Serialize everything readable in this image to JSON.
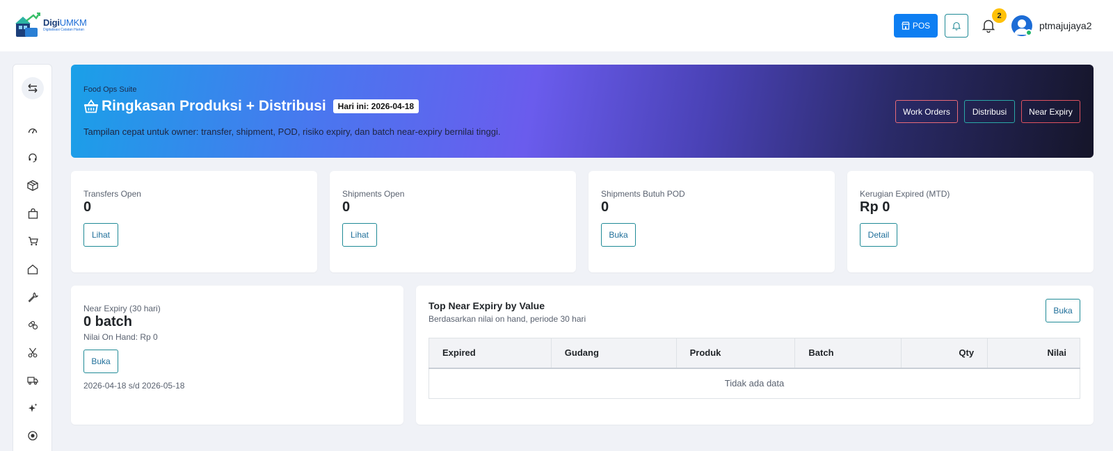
{
  "brand": {
    "name_bold": "Digi",
    "name_rest": "UMKM",
    "tagline": "Digitalisasi Catatan Harian"
  },
  "topbar": {
    "pos_label": "POS",
    "notif_count": "2",
    "username": "ptmajujaya2"
  },
  "hero": {
    "kicker": "Food Ops Suite",
    "title": "Ringkasan Produksi + Distribusi",
    "date_badge": "Hari ini: 2026-04-18",
    "description": "Tampilan cepat untuk owner: transfer, shipment, POD, risiko expiry, dan batch near-expiry bernilai tinggi.",
    "buttons": [
      "Work Orders",
      "Distribusi",
      "Near Expiry"
    ]
  },
  "colors": {
    "primary": "#0d7ef2",
    "teal": "#1f8a96",
    "danger": "#e05260",
    "warning": "#ffc107"
  },
  "stats": [
    {
      "label": "Transfers Open",
      "value": "0",
      "button": "Lihat"
    },
    {
      "label": "Shipments Open",
      "value": "0",
      "button": "Lihat"
    },
    {
      "label": "Shipments Butuh POD",
      "value": "0",
      "button": "Buka"
    },
    {
      "label": "Kerugian Expired (MTD)",
      "value": "Rp 0",
      "button": "Detail"
    }
  ],
  "near_expiry": {
    "label": "Near Expiry (30 hari)",
    "value": "0 batch",
    "on_hand": "Nilai On Hand: Rp 0",
    "button": "Buka",
    "range": "2026-04-18 s/d 2026-05-18"
  },
  "top_table": {
    "title": "Top Near Expiry by Value",
    "subtitle": "Berdasarkan nilai on hand, periode 30 hari",
    "button": "Buka",
    "columns": [
      "Expired",
      "Gudang",
      "Produk",
      "Batch",
      "Qty",
      "Nilai"
    ],
    "empty": "Tidak ada data"
  },
  "sidebar_icons": [
    "swap-icon",
    "dashboard-icon",
    "headset-icon",
    "box-icon",
    "bag-icon",
    "cart-icon",
    "home-icon",
    "wrench-icon",
    "pills-icon",
    "scissors-icon",
    "truck-icon",
    "sparkle-icon",
    "record-icon"
  ]
}
